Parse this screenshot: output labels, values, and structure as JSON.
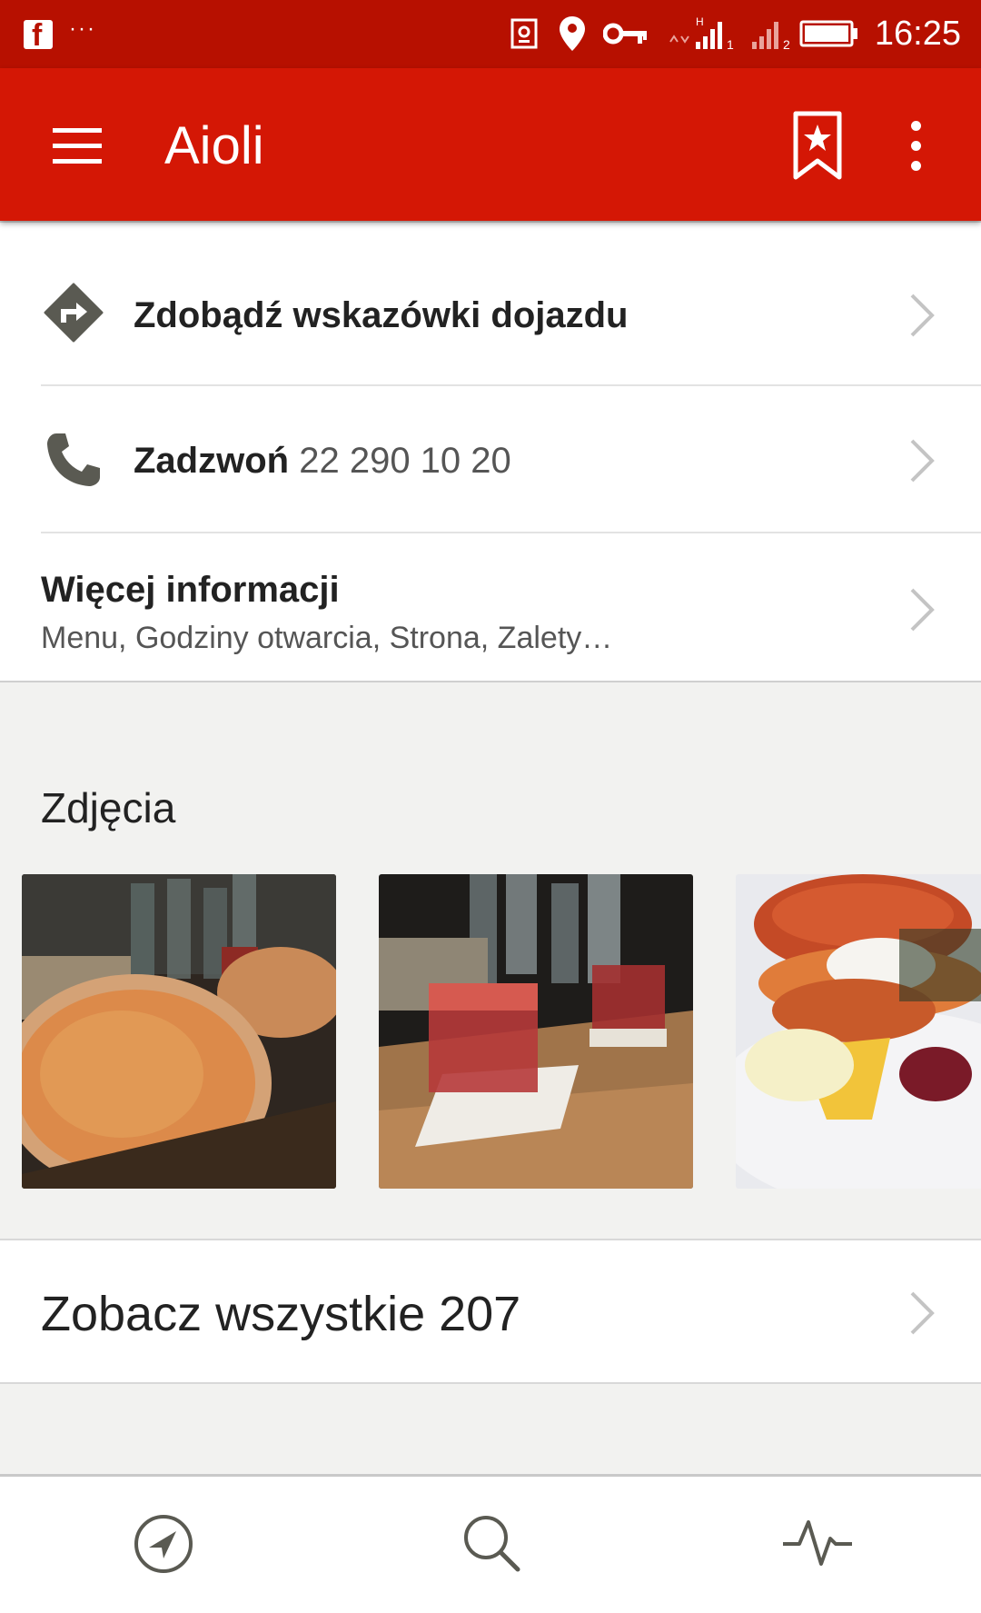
{
  "status_bar": {
    "time": "16:25",
    "more_indicator": "···"
  },
  "app_bar": {
    "title": "Aioli"
  },
  "actions": {
    "directions": {
      "label": "Zdobądź wskazówki dojazdu"
    },
    "call": {
      "label": "Zadzwoń",
      "phone": "22 290 10 20"
    },
    "more_info": {
      "label": "Więcej informacji",
      "description": "Menu, Godziny otwarcia, Strona, Zalety…"
    }
  },
  "photos": {
    "title": "Zdjęcia",
    "items": [
      {
        "subject": "pizza"
      },
      {
        "subject": "drinks"
      },
      {
        "subject": "burger"
      }
    ],
    "see_all_label": "Zobacz wszystkie 207"
  },
  "bottom_nav": {
    "items": [
      {
        "icon": "navigation-arrow-icon"
      },
      {
        "icon": "search-icon"
      },
      {
        "icon": "activity-icon"
      }
    ]
  },
  "colors": {
    "status_bar": "#b71000",
    "app_bar": "#d41705",
    "background": "#f2f2f0",
    "icon_gray": "#5a5a52"
  }
}
